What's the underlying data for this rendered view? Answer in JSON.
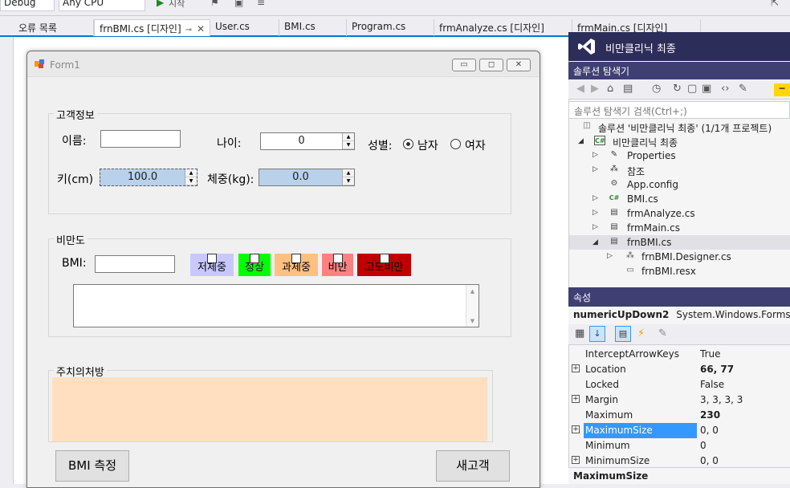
{
  "toolbar": {
    "config_combo": "Debug",
    "platform_combo": "Any CPU",
    "start_label": "시작"
  },
  "tabs": [
    {
      "label": "오류 목록"
    },
    {
      "label": "frnBMI.cs [디자인]",
      "active": true
    },
    {
      "label": "User.cs"
    },
    {
      "label": "BMI.cs"
    },
    {
      "label": "Program.cs"
    },
    {
      "label": "frmAnalyze.cs [디자인]"
    },
    {
      "label": "frmMain.cs [디자인]"
    }
  ],
  "form": {
    "title": "Form1",
    "group_customer": {
      "legend": "고객정보",
      "name_label": "이름:",
      "age_label": "나이:",
      "age_value": "0",
      "gender_label": "성별:",
      "male_label": "남자",
      "female_label": "여자",
      "height_label": "키(cm)",
      "height_value": "100.0",
      "weight_label": "체중(kg):",
      "weight_value": "0.0"
    },
    "group_obesity": {
      "legend": "비만도",
      "bmi_label": "BMI:",
      "chips": [
        {
          "label": "저체중",
          "color": "#c8c8ff"
        },
        {
          "label": "정상",
          "color": "#00ff00"
        },
        {
          "label": "과체중",
          "color": "#ffc080"
        },
        {
          "label": "비만",
          "color": "#ff8080"
        },
        {
          "label": "고도비만",
          "color": "#c00000"
        }
      ]
    },
    "group_prescription": {
      "legend": "주치의처방",
      "bg_color": "#ffdfc0"
    },
    "measure_button": "BMI 측정",
    "new_customer_button": "새고객"
  },
  "solution_explorer": {
    "app_title": "비만클리닉 최종",
    "panel_title": "솔루션 탐색기",
    "search_placeholder": "솔루션 탐색기 검색(Ctrl+;)",
    "items": [
      {
        "label": "솔루션 '비만클리닉 최종' (1/1개 프로젝트)",
        "icon": "solution-icon"
      },
      {
        "label": "비만클리닉 최종",
        "icon": "csharp-project-icon"
      },
      {
        "label": "Properties",
        "icon": "wrench-icon"
      },
      {
        "label": "참조",
        "icon": "references-icon"
      },
      {
        "label": "App.config",
        "icon": "config-file-icon"
      },
      {
        "label": "BMI.cs",
        "icon": "csharp-file-icon"
      },
      {
        "label": "frmAnalyze.cs",
        "icon": "form-icon"
      },
      {
        "label": "frmMain.cs",
        "icon": "form-icon"
      },
      {
        "label": "frnBMI.cs",
        "icon": "form-icon"
      },
      {
        "label": "frnBMI.Designer.cs",
        "icon": "csharp-file-icon"
      },
      {
        "label": "frnBMI.resx",
        "icon": "resx-icon"
      }
    ]
  },
  "properties": {
    "panel_title": "속성",
    "object_name": "numericUpDown2",
    "object_type": "System.Windows.Forms.NumericUpDown",
    "rows": [
      {
        "name": "InterceptArrowKeys",
        "value": "True",
        "expandable": false,
        "bold": false
      },
      {
        "name": "Location",
        "value": "66, 77",
        "expandable": true,
        "bold": true
      },
      {
        "name": "Locked",
        "value": "False",
        "expandable": false,
        "bold": false
      },
      {
        "name": "Margin",
        "value": "3, 3, 3, 3",
        "expandable": true,
        "bold": false
      },
      {
        "name": "Maximum",
        "value": "230",
        "expandable": false,
        "bold": true
      },
      {
        "name": "MaximumSize",
        "value": "0, 0",
        "expandable": true,
        "bold": false,
        "selected": true
      },
      {
        "name": "Minimum",
        "value": "0",
        "expandable": false,
        "bold": false
      },
      {
        "name": "MinimumSize",
        "value": "0, 0",
        "expandable": true,
        "bold": false
      }
    ],
    "description_title": "MaximumSize"
  }
}
